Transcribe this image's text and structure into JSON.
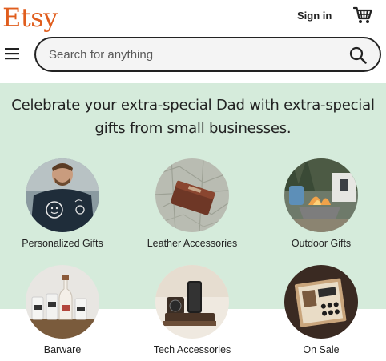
{
  "header": {
    "logo": "Etsy",
    "sign_in": "Sign in",
    "cart_icon": "shopping-cart-icon",
    "menu_icon": "hamburger-menu-icon"
  },
  "search": {
    "placeholder": "Search for anything",
    "icon": "search-icon"
  },
  "hero": {
    "title": "Celebrate your extra-special Dad with extra-special gifts from small businesses.",
    "background": "#d5ebdb"
  },
  "categories": [
    {
      "label": "Personalized Gifts"
    },
    {
      "label": "Leather Accessories"
    },
    {
      "label": "Outdoor Gifts"
    },
    {
      "label": "Barware"
    },
    {
      "label": "Tech Accessories"
    },
    {
      "label": "On Sale"
    }
  ],
  "colors": {
    "brand": "#e05d1d",
    "text": "#222222"
  }
}
